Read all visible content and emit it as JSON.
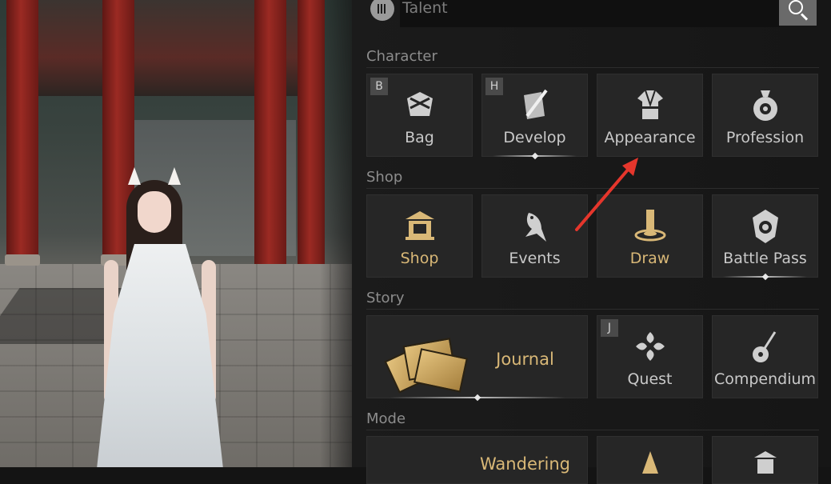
{
  "search": {
    "placeholder": "Talent"
  },
  "sections": {
    "character": "Character",
    "shop": "Shop",
    "story": "Story",
    "mode": "Mode"
  },
  "character": [
    {
      "label": "Bag",
      "key": "B",
      "icon": "bag-icon"
    },
    {
      "label": "Develop",
      "key": "H",
      "icon": "develop-icon"
    },
    {
      "label": "Appearance",
      "icon": "robe-icon"
    },
    {
      "label": "Profession",
      "icon": "profession-icon"
    }
  ],
  "shop": [
    {
      "label": "Shop",
      "icon": "shop-icon",
      "color": "#d9b877"
    },
    {
      "label": "Events",
      "icon": "bird-icon"
    },
    {
      "label": "Draw",
      "icon": "bell-icon",
      "color": "#d9b877"
    },
    {
      "label": "Battle Pass",
      "icon": "badge-icon"
    }
  ],
  "story": [
    {
      "label": "Journal",
      "icon": "journal-icon",
      "color": "#d9b877"
    },
    {
      "label": "Quest",
      "key": "J",
      "icon": "quest-icon"
    },
    {
      "label": "Compendium",
      "icon": "lute-icon"
    }
  ],
  "mode": [
    {
      "label": "Wandering"
    }
  ],
  "colors": {
    "gold": "#d9b877",
    "annotation_arrow": "#e5362c"
  }
}
